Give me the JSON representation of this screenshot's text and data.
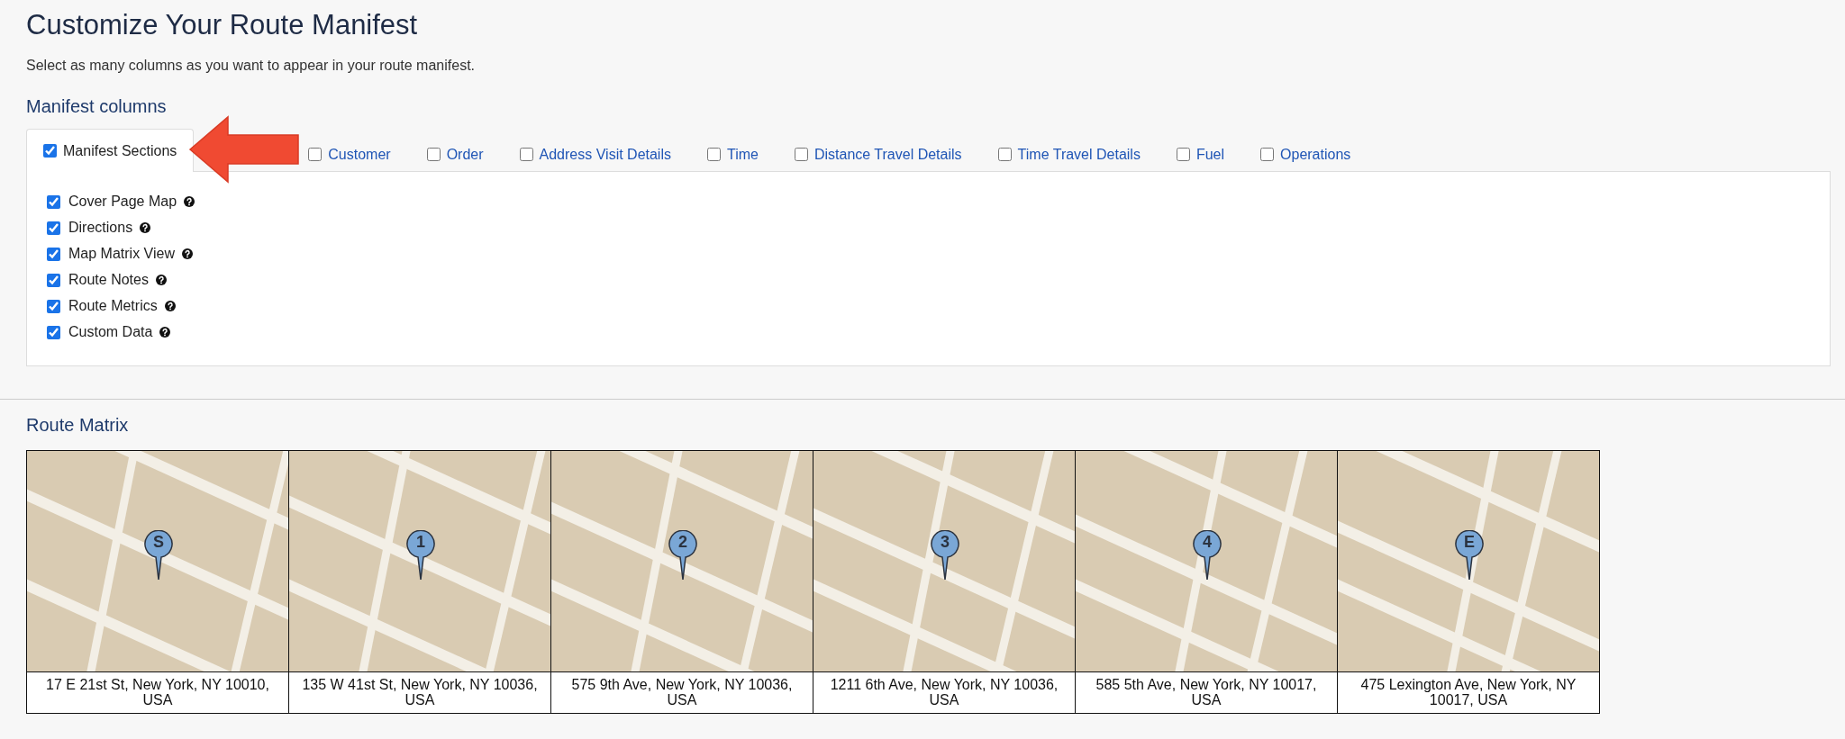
{
  "title": "Customize Your Route Manifest",
  "subtitle": "Select as many columns as you want to appear in your route manifest.",
  "manifest_columns": {
    "heading": "Manifest columns",
    "tabs": [
      {
        "label": "Manifest Sections",
        "selected": true,
        "checked": true
      },
      {
        "label": "Customer",
        "selected": false,
        "checked": false
      },
      {
        "label": "Order",
        "selected": false,
        "checked": false
      },
      {
        "label": "Address Visit Details",
        "selected": false,
        "checked": false
      },
      {
        "label": "Time",
        "selected": false,
        "checked": false
      },
      {
        "label": "Distance Travel Details",
        "selected": false,
        "checked": false
      },
      {
        "label": "Time Travel Details",
        "selected": false,
        "checked": false
      },
      {
        "label": "Fuel",
        "selected": false,
        "checked": false
      },
      {
        "label": "Operations",
        "selected": false,
        "checked": false
      }
    ],
    "options": [
      {
        "label": "Cover Page Map",
        "checked": true
      },
      {
        "label": "Directions",
        "checked": true
      },
      {
        "label": "Map Matrix View",
        "checked": true
      },
      {
        "label": "Route Notes",
        "checked": true
      },
      {
        "label": "Route Metrics",
        "checked": true
      },
      {
        "label": "Custom Data",
        "checked": true
      }
    ]
  },
  "route_matrix": {
    "heading": "Route Matrix",
    "stops": [
      {
        "pin": "S",
        "address": "17 E 21st St, New York, NY 10010, USA"
      },
      {
        "pin": "1",
        "address": "135 W 41st St, New York, NY 10036, USA"
      },
      {
        "pin": "2",
        "address": "575 9th Ave, New York, NY 10036, USA"
      },
      {
        "pin": "3",
        "address": "1211 6th Ave, New York, NY 10036, USA"
      },
      {
        "pin": "4",
        "address": "585 5th Ave, New York, NY 10017, USA"
      },
      {
        "pin": "E",
        "address": "475 Lexington Ave, New York, NY 10017, USA"
      }
    ]
  }
}
